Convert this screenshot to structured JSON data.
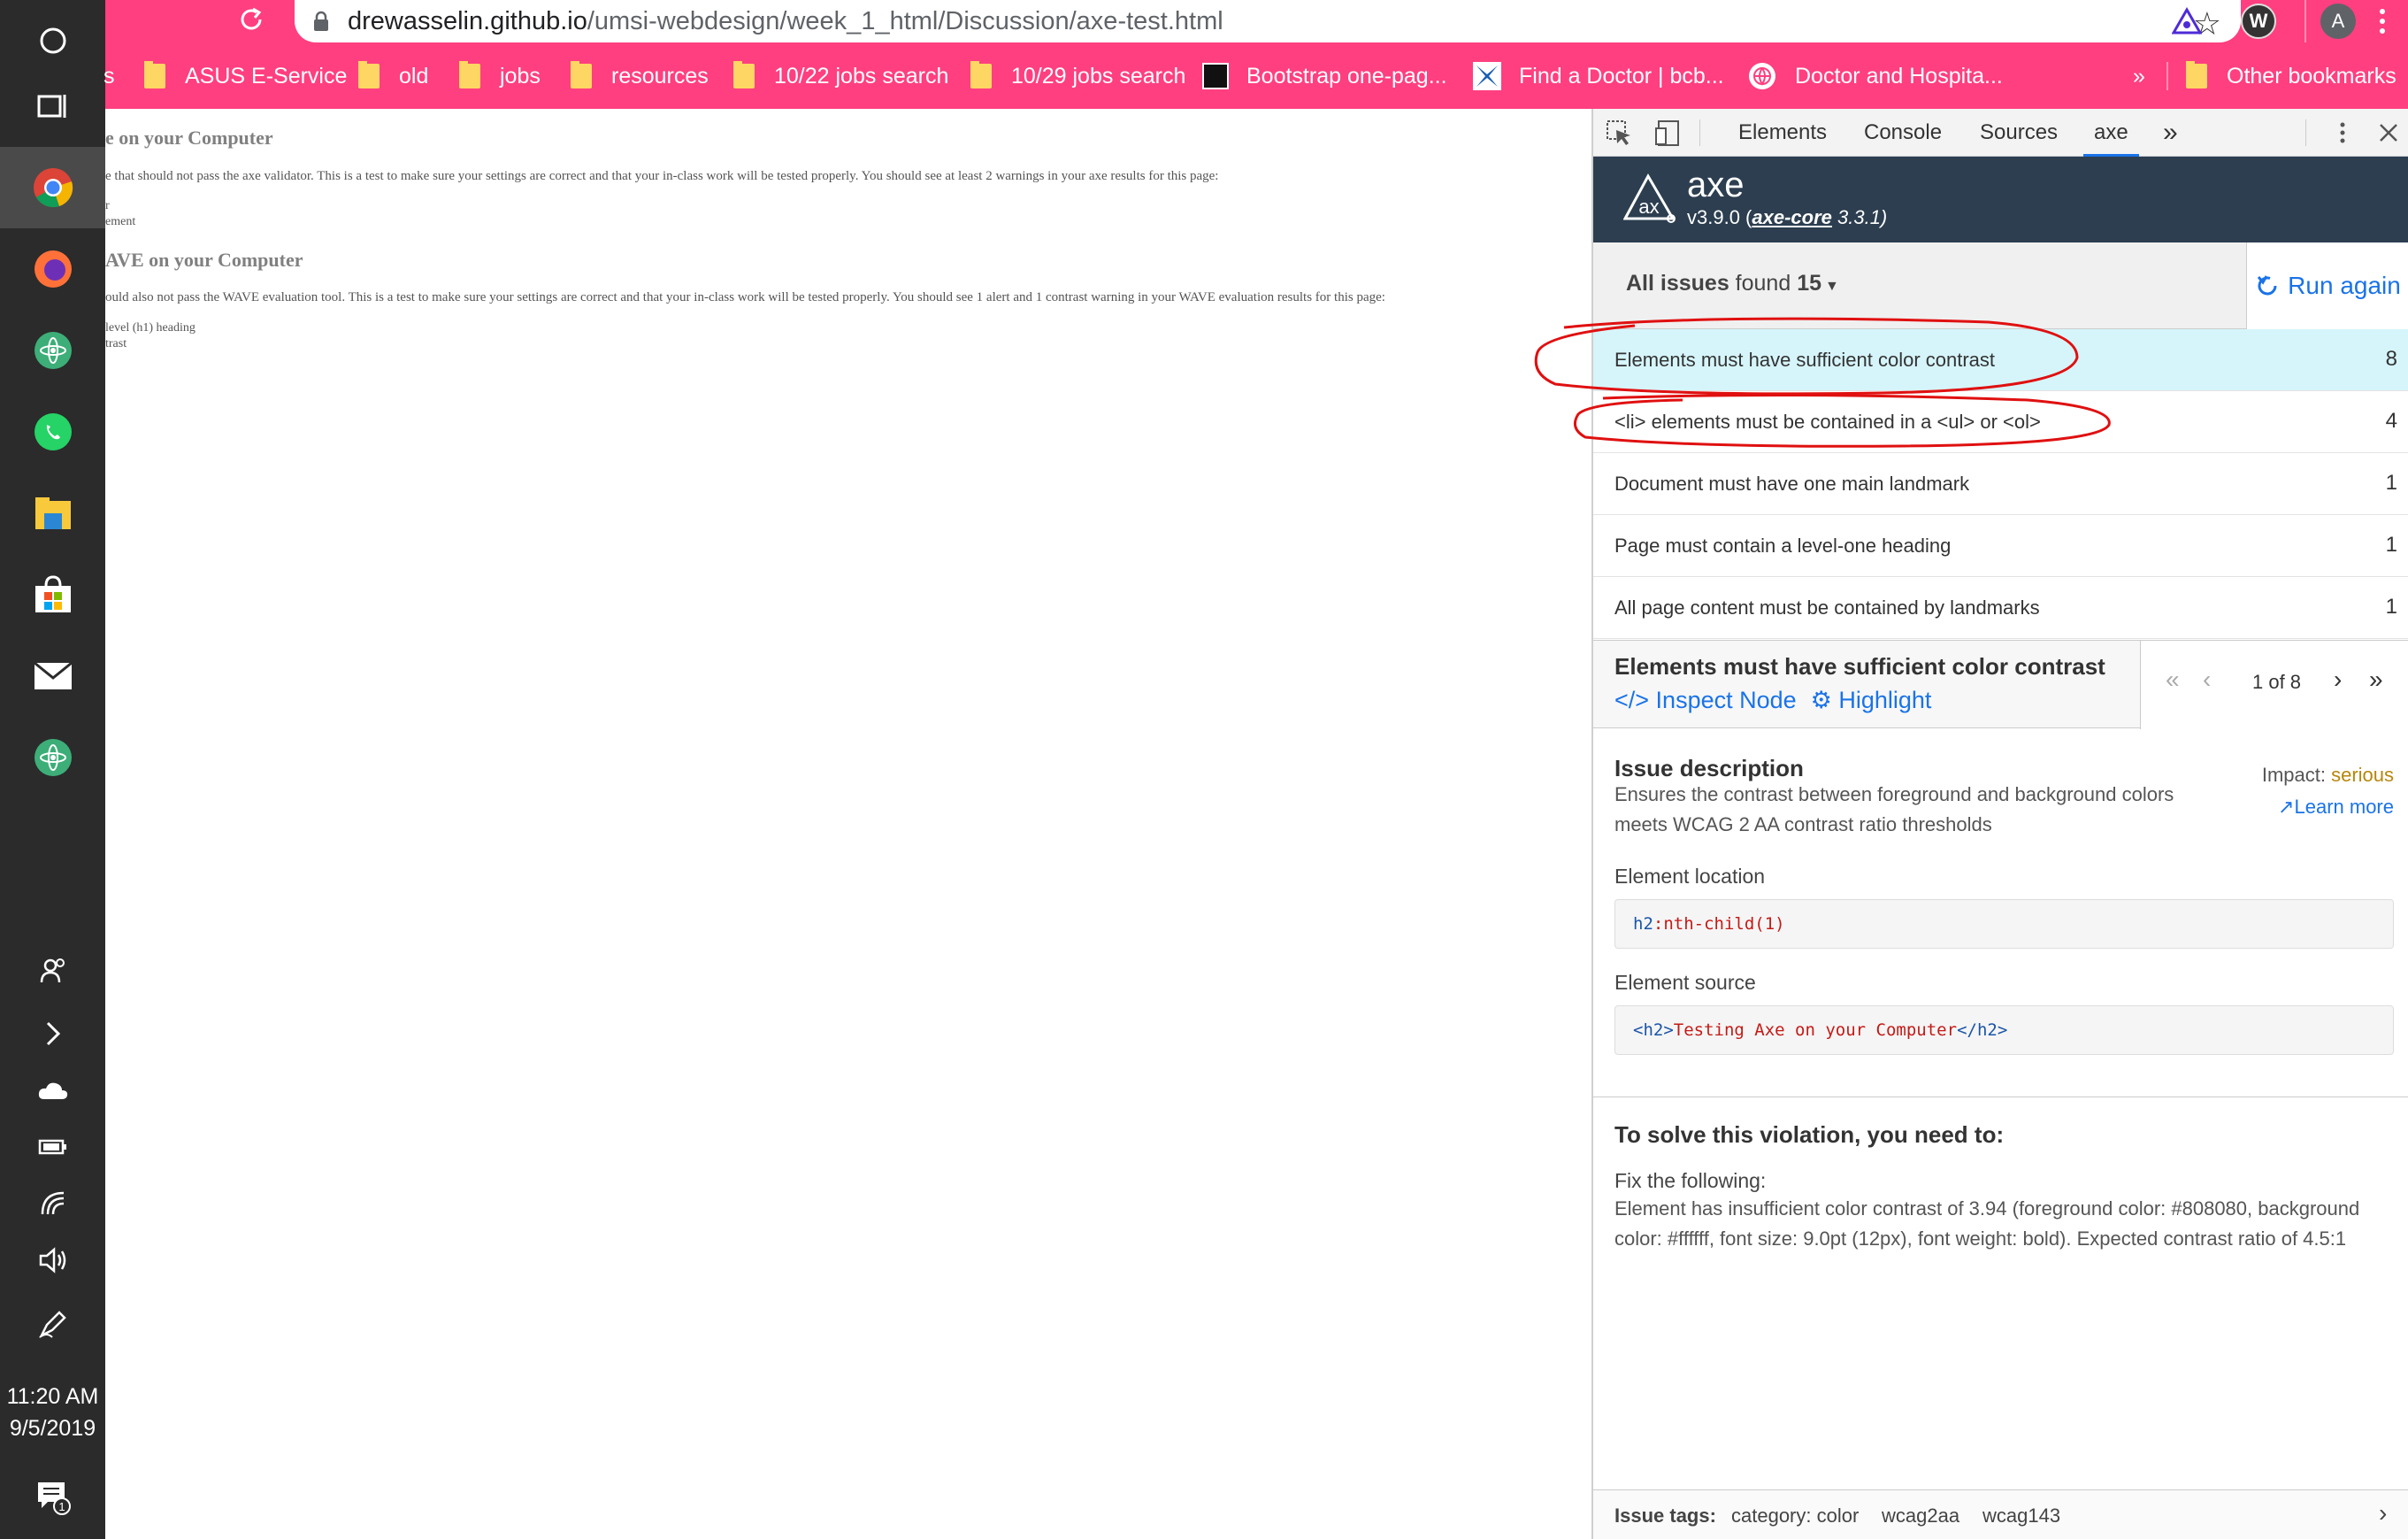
{
  "taskbar": {
    "time": "11:20 AM",
    "date": "9/5/2019",
    "notification_count": "1"
  },
  "browser": {
    "url_host": "drewasselin.github.io",
    "url_path": "/umsi-webdesign/week_1_html/Discussion/axe-test.html",
    "profile_initial": "A",
    "wappalyzer_letter": "W",
    "bookmarks": [
      {
        "label": "s"
      },
      {
        "label": "ASUS E-Service"
      },
      {
        "label": "old"
      },
      {
        "label": "jobs"
      },
      {
        "label": "resources"
      },
      {
        "label": "10/22 jobs search"
      },
      {
        "label": "10/29 jobs search"
      },
      {
        "label": "Bootstrap one-pag..."
      },
      {
        "label": "Find a Doctor | bcb..."
      },
      {
        "label": "Doctor and Hospita..."
      }
    ],
    "overflow": "»",
    "other_bookmarks": "Other bookmarks"
  },
  "page": {
    "h2_axe": "e on your Computer",
    "p_axe": "e that should not pass the axe validator. This is a test to make sure your settings are correct and that your in-class work will be tested properly. You should see at least 2 warnings in your axe results for this page:",
    "li_axe_1": "r",
    "li_axe_2": "ement",
    "h2_wave": "AVE on your Computer",
    "p_wave": "ould also not pass the WAVE evaluation tool. This is a test to make sure your settings are correct and that your in-class work will be tested properly. You should see 1 alert and 1 contrast warning in your WAVE evaluation results for this page:",
    "li_wave_1": "level (h1) heading",
    "li_wave_2": "trast"
  },
  "devtools": {
    "tabs": [
      "Elements",
      "Console",
      "Sources",
      "axe"
    ],
    "more": "»",
    "axe": {
      "name": "axe",
      "version": "v3.9.0 (",
      "core_link": "axe-core",
      "core_version": " 3.3.1)",
      "issues_label": "All issues",
      "found_label": " found ",
      "issues_count": "15",
      "run_again": "Run again",
      "issues": [
        {
          "text": "Elements must have sufficient color contrast",
          "count": "8"
        },
        {
          "text": "<li> elements must be contained in a <ul> or <ol>",
          "count": "4"
        },
        {
          "text": "Document must have one main landmark",
          "count": "1"
        },
        {
          "text": "Page must contain a level-one heading",
          "count": "1"
        },
        {
          "text": "All page content must be contained by landmarks",
          "count": "1"
        }
      ],
      "detail": {
        "title": "Elements must have sufficient color contrast",
        "inspect_node": "Inspect Node",
        "highlight": "Highlight",
        "pager": "1 of 8",
        "issue_description_title": "Issue description",
        "issue_description": "Ensures the contrast between foreground and background colors meets WCAG 2 AA contrast ratio thresholds",
        "impact_label": "Impact: ",
        "impact_value": "serious",
        "learn_more": "Learn more",
        "element_location_label": "Element location",
        "location_tag": "h2",
        "location_sel": ":nth-child(1)",
        "element_source_label": "Element source",
        "source_open": "<h2>",
        "source_text": "Testing Axe on your Computer",
        "source_close": "</h2>",
        "solve_title": "To solve this violation, you need to:",
        "fix_label": "Fix the following:",
        "fix_text": "Element has insufficient color contrast of 3.94 (foreground color: #808080, background color: #ffffff, font size: 9.0pt (12px), font weight: bold). Expected contrast ratio of 4.5:1",
        "tags_label": "Issue tags:",
        "tags": [
          "category: color",
          "wcag2aa",
          "wcag143"
        ]
      }
    }
  },
  "colors": {
    "chrome_pink": "#ff3f7f",
    "axe_header": "#2c3e50",
    "link_blue": "#1a73e8",
    "selected_row": "#d6f5fb",
    "impact_serious": "#b8860b",
    "annotation_red": "#e01010"
  }
}
